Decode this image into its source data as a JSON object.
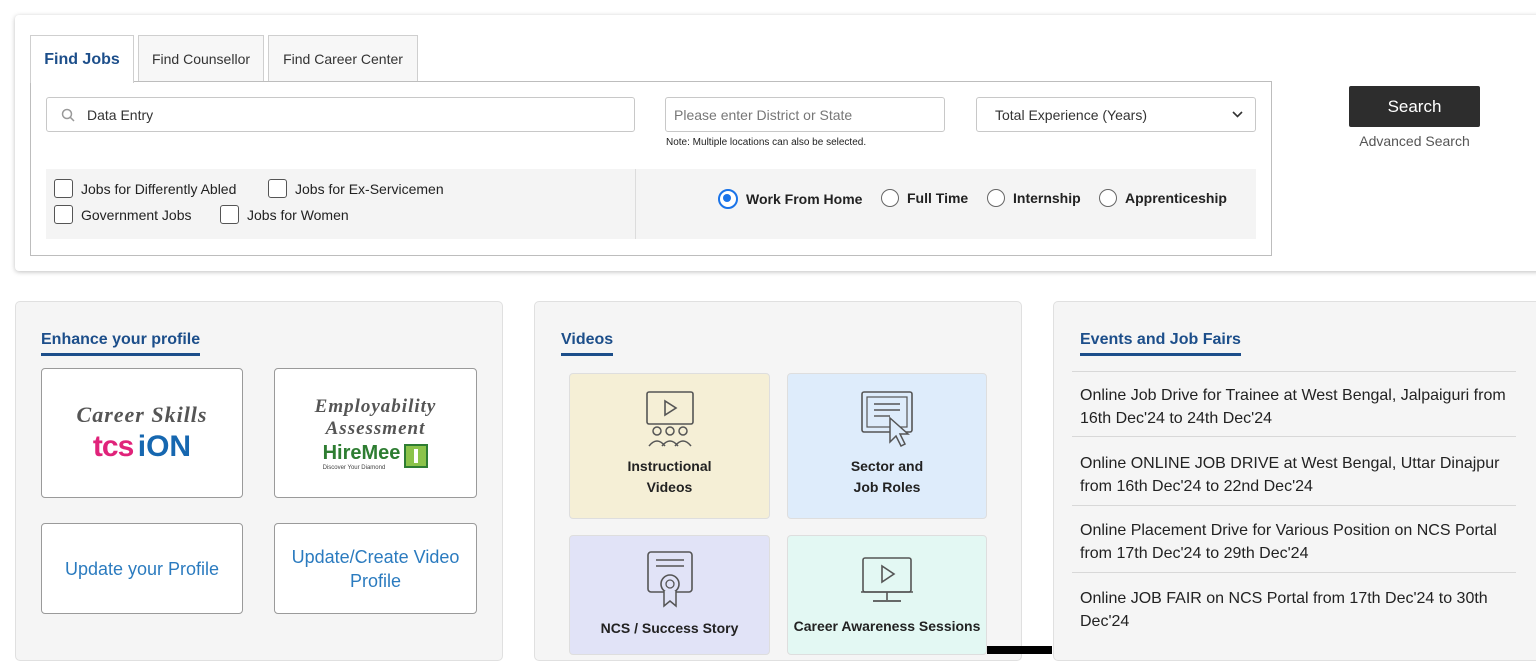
{
  "tabs": [
    {
      "label": "Find Jobs",
      "active": true
    },
    {
      "label": "Find Counsellor",
      "active": false
    },
    {
      "label": "Find Career Center",
      "active": false
    }
  ],
  "search": {
    "keyword_value": "Data Entry",
    "location_placeholder": "Please enter District or State",
    "location_note": "Note: Multiple locations can also be selected.",
    "experience_selected": "Total Experience (Years)",
    "search_label": "Search",
    "advanced_label": "Advanced Search"
  },
  "filters": {
    "checkboxes": [
      "Jobs for Differently Abled",
      "Jobs for Ex-Servicemen",
      "Government Jobs",
      "Jobs for Women"
    ],
    "radios": [
      {
        "label": "Work From Home",
        "selected": true
      },
      {
        "label": "Full Time",
        "selected": false
      },
      {
        "label": "Internship",
        "selected": false
      },
      {
        "label": "Apprenticeship",
        "selected": false
      }
    ]
  },
  "profile": {
    "title": "Enhance your profile",
    "career_skills": {
      "line1": "Career Skills",
      "brand_a": "tcs",
      "brand_b": "iON"
    },
    "employability": {
      "line1": "Employability",
      "line2": "Assessment",
      "brand": "HireMee",
      "tagline": "Discover Your Diamond"
    },
    "update_profile": "Update your Profile",
    "update_video": "Update/Create Video Profile"
  },
  "videos": {
    "title": "Videos",
    "items": [
      {
        "line1": "Instructional",
        "line2": "Videos",
        "bg": "#f5efd6",
        "icon": "video-group-icon"
      },
      {
        "line1": "Sector and",
        "line2": "Job Roles",
        "bg": "#deecfb",
        "icon": "screen-pointer-icon"
      },
      {
        "line1": "NCS / Success Story",
        "line2": "",
        "bg": "#e1e3f7",
        "icon": "certificate-icon"
      },
      {
        "line1": "Career Awareness Sessions",
        "line2": "",
        "bg": "#e3f8f3",
        "icon": "monitor-play-icon"
      }
    ]
  },
  "events": {
    "title": "Events and Job Fairs",
    "items": [
      "Online Job Drive for Trainee at West Bengal, Jalpaiguri from 16th Dec'24 to 24th Dec'24",
      "Online ONLINE JOB DRIVE at West Bengal, Uttar Dinajpur from 16th Dec'24 to 22nd Dec'24",
      "Online Placement Drive for Various Position on NCS Portal from 17th Dec'24 to 29th Dec'24",
      "Online JOB FAIR on NCS Portal from 17th Dec'24 to 30th Dec'24"
    ]
  },
  "colors": {
    "accent": "#1c4e8a",
    "link": "#2b7bbf",
    "radio": "#1a73e8",
    "button": "#2d2d2d"
  }
}
